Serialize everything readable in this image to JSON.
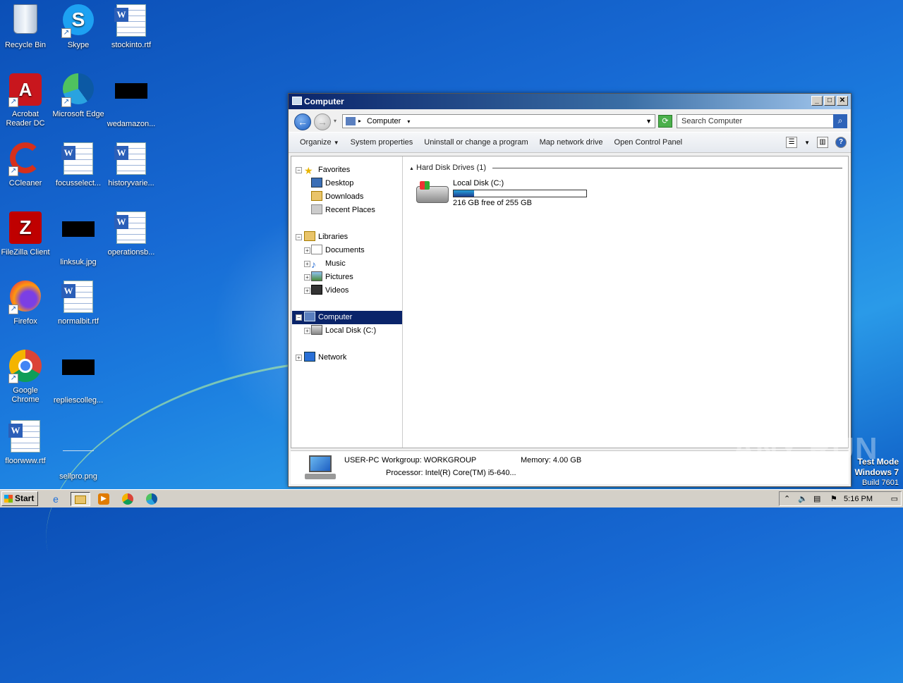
{
  "desktop": {
    "icons": [
      {
        "label": "Recycle Bin"
      },
      {
        "label": "Skype"
      },
      {
        "label": "stockinto.rtf"
      },
      {
        "label": "Acrobat Reader DC"
      },
      {
        "label": "Microsoft Edge"
      },
      {
        "label": "wedamazon..."
      },
      {
        "label": "CCleaner"
      },
      {
        "label": "focusselect..."
      },
      {
        "label": "historyvarie..."
      },
      {
        "label": "FileZilla Client"
      },
      {
        "label": "linksuk.jpg"
      },
      {
        "label": "operationsb..."
      },
      {
        "label": "Firefox"
      },
      {
        "label": "normalbit.rtf"
      },
      {
        "label": "Google Chrome"
      },
      {
        "label": "repliescolleg..."
      },
      {
        "label": "floorwww.rtf"
      },
      {
        "label": "sellpro.png"
      }
    ]
  },
  "window": {
    "title": "Computer",
    "address": "Computer",
    "search_placeholder": "Search Computer",
    "toolbar": {
      "organize": "Organize",
      "system_properties": "System properties",
      "uninstall": "Uninstall or change a program",
      "map_drive": "Map network drive",
      "control_panel": "Open Control Panel"
    },
    "nav": {
      "favorites": "Favorites",
      "desktop": "Desktop",
      "downloads": "Downloads",
      "recent": "Recent Places",
      "libraries": "Libraries",
      "documents": "Documents",
      "music": "Music",
      "pictures": "Pictures",
      "videos": "Videos",
      "computer": "Computer",
      "local_disk": "Local Disk (C:)",
      "network": "Network"
    },
    "main": {
      "group_header": "Hard Disk Drives (1)",
      "drive_name": "Local Disk (C:)",
      "drive_free": "216 GB free of 255 GB",
      "drive_used_fraction": 0.153
    },
    "details": {
      "pc_name": "USER-PC",
      "workgroup": "Workgroup: WORKGROUP",
      "memory": "Memory: 4.00 GB",
      "processor": "Processor: Intel(R) Core(TM) i5-640..."
    }
  },
  "watermark": "ANY RUN",
  "testmode": {
    "line1": "Test Mode",
    "line2": "Windows 7",
    "line3": "Build 7601"
  },
  "taskbar": {
    "start_label": "Start",
    "clock": "5:16 PM"
  }
}
